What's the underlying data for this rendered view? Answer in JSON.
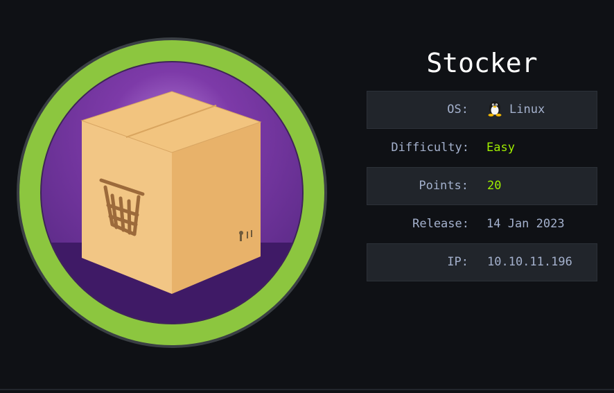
{
  "machine": {
    "name": "Stocker",
    "badge_icon": "package-box-with-basket-icon",
    "colors": {
      "background": "#0f1115",
      "ring": "#8cc63f",
      "inner": "#6a2c91",
      "accent": "#9fef00",
      "text": "#a4b1cd"
    }
  },
  "info": {
    "os_label": "OS:",
    "os_value": "Linux",
    "os_icon": "tux-penguin-icon",
    "difficulty_label": "Difficulty:",
    "difficulty_value": "Easy",
    "points_label": "Points:",
    "points_value": "20",
    "release_label": "Release:",
    "release_value": "14 Jan 2023",
    "ip_label": "IP:",
    "ip_value": "10.10.11.196"
  }
}
